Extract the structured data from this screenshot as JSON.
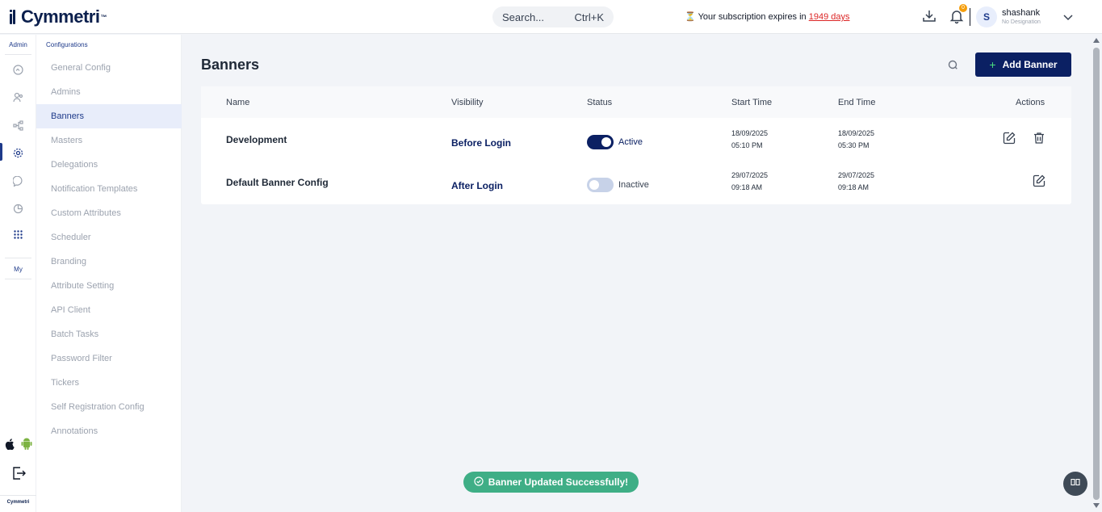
{
  "app": {
    "logo_text": "Cymmetri",
    "logo_tm": "™",
    "footer_logo": "Cymmetri"
  },
  "header": {
    "search_placeholder": "Search...",
    "search_shortcut": "Ctrl+K",
    "subscription_prefix": "Your subscription expires in",
    "subscription_days": "1949 days",
    "notification_count": "0",
    "user_initial": "S",
    "user_name": "shashank",
    "user_designation": "No Designation"
  },
  "rail": {
    "admin_label": "Admin",
    "my_label": "My",
    "icons": [
      "dashboard-icon",
      "users-icon",
      "hierarchy-icon",
      "settings-icon",
      "chat-icon",
      "report-icon",
      "apps-grid-icon"
    ],
    "active_icon": "settings-icon"
  },
  "config_sidebar": {
    "heading": "Configurations",
    "items": [
      "General Config",
      "Admins",
      "Banners",
      "Masters",
      "Delegations",
      "Notification Templates",
      "Custom Attributes",
      "Scheduler",
      "Branding",
      "Attribute Setting",
      "API Client",
      "Batch Tasks",
      "Password Filter",
      "Tickers",
      "Self Registration Config",
      "Annotations"
    ],
    "active_item": "Banners"
  },
  "main": {
    "title": "Banners",
    "add_button_label": "Add Banner",
    "table": {
      "headers": {
        "name": "Name",
        "visibility": "Visibility",
        "status": "Status",
        "start": "Start Time",
        "end": "End Time",
        "actions": "Actions"
      },
      "rows": [
        {
          "name": "Development",
          "visibility": "Before Login",
          "status": "Active",
          "active": true,
          "start_date": "18/09/2025",
          "start_time": "05:10 PM",
          "end_date": "18/09/2025",
          "end_time": "05:30 PM",
          "deletable": true
        },
        {
          "name": "Default Banner Config",
          "visibility": "After Login",
          "status": "Inactive",
          "active": false,
          "start_date": "29/07/2025",
          "start_time": "09:18 AM",
          "end_date": "29/07/2025",
          "end_time": "09:18 AM",
          "deletable": false
        }
      ]
    }
  },
  "toast": {
    "message": "Banner Updated Successfully!"
  },
  "colors": {
    "brand_navy": "#0b2063",
    "toast_green": "#3fae86",
    "danger": "#dc2626",
    "accent_green": "#4ade80"
  }
}
